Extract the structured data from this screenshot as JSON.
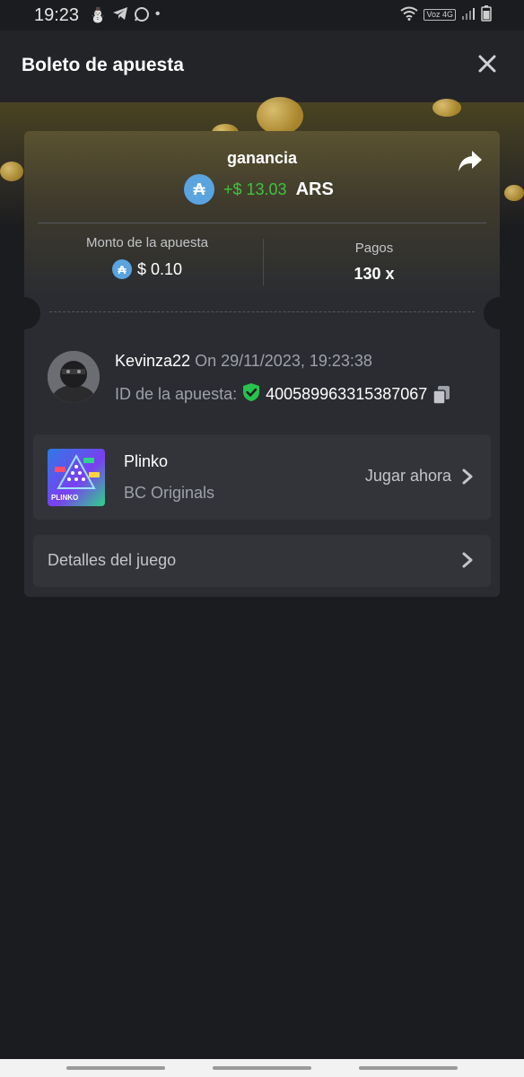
{
  "status_bar": {
    "time": "19:23",
    "network_label": "Voz 4G"
  },
  "header": {
    "title": "Boleto de apuesta"
  },
  "winnings": {
    "label": "ganancia",
    "amount": "+$ 13.03",
    "currency": "ARS",
    "coin_symbol": "₳"
  },
  "stats": {
    "bet_amount_label": "Monto de la apuesta",
    "bet_amount_value": "$ 0.10",
    "payout_label": "Pagos",
    "payout_value": "130 x"
  },
  "player": {
    "username": "Kevinza22",
    "date": "On 29/11/2023, 19:23:38",
    "bet_id_label": "ID de la apuesta:",
    "bet_id": "400589963315387067"
  },
  "game": {
    "name": "Plinko",
    "provider": "BC Originals",
    "play_label": "Jugar ahora",
    "thumb_label": "PLINKO"
  },
  "details": {
    "label": "Detalles del juego"
  },
  "colors": {
    "accent_green": "#3ec43e",
    "coin_blue": "#5aa4e0",
    "card_bg": "#2a2c31"
  }
}
